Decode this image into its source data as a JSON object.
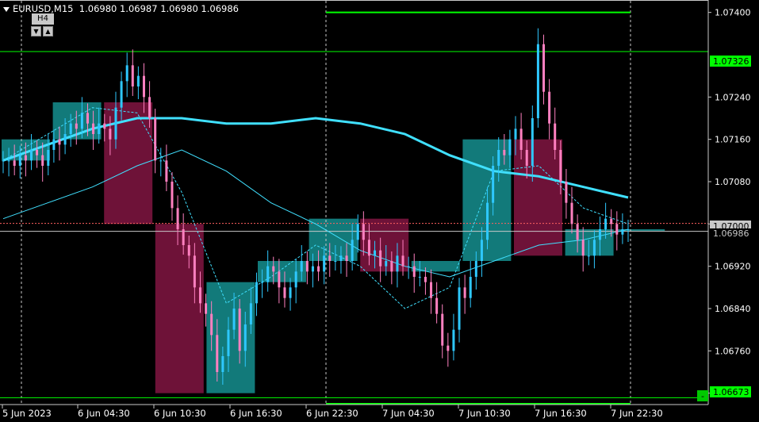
{
  "header": {
    "symbol_label": "EURUSD,M15",
    "ohlc": "1.06980 1.06987 1.06980 1.06986",
    "timeframe_label": "H4",
    "down_button": "▼",
    "up_button": "▲"
  },
  "price_axis": {
    "ticks": [
      "1.07400",
      "1.07240",
      "1.07160",
      "1.07080",
      "1.07000",
      "1.06920",
      "1.06840",
      "1.06760",
      "1.06680"
    ],
    "tick_values": [
      1.074,
      1.0724,
      1.0716,
      1.0708,
      1.07,
      1.0692,
      1.0684,
      1.0676,
      1.0668
    ],
    "ymin": 1.06663,
    "ymax": 1.07422
  },
  "time_axis": {
    "labels": [
      "5 Jun 2023",
      "6 Jun 04:30",
      "6 Jun 10:30",
      "6 Jun 16:30",
      "6 Jun 22:30",
      "7 Jun 04:30",
      "7 Jun 10:30",
      "7 Jun 16:30",
      "7 Jun 22:30"
    ]
  },
  "horizontal_lines": {
    "upper_level": {
      "value": 1.07326,
      "label": "1.07326",
      "color": "#00ff00"
    },
    "lower_level": {
      "value": 1.06673,
      "label": "1.06673",
      "color": "#00ff00"
    },
    "bid_line": {
      "value": 1.06986,
      "label": "1.06986",
      "color": "#c8c8c8"
    },
    "ask_line": {
      "value": 1.07001,
      "color": "#ff6060"
    },
    "range_top": {
      "value": 1.074,
      "color": "#00ff00"
    },
    "range_bottom": {
      "value": 1.0666,
      "color": "#00ff00"
    }
  },
  "price_tags": {
    "ask_tag": "1.07000",
    "bid_tag": "1.06986",
    "upper_tag": "1.07326",
    "lower_tag": "1.06673",
    "marker": "-"
  },
  "colors": {
    "bull_candle": "#2ec8ff",
    "bear_candle": "#ff80c0",
    "bull_h4_box": "#127a7a",
    "bear_h4_box": "#6e1238",
    "ma_slow": "#40e0ff",
    "ma_mid": "#40e0ff",
    "ma_fast_dashed": "#40e0ff",
    "grid_vertical": "#c8c8c8",
    "axis": "#c8c8c8"
  },
  "chart_data": {
    "type": "candlestick",
    "symbol": "EURUSD",
    "timeframe": "M15",
    "h4_boxes": [
      {
        "open": 1.0712,
        "close": 1.0716
      },
      {
        "open": 1.0716,
        "close": 1.0723
      },
      {
        "open": 1.0723,
        "close": 1.07
      },
      {
        "open": 1.07,
        "close": 1.0668
      },
      {
        "open": 1.0668,
        "close": 1.0689
      },
      {
        "open": 1.0689,
        "close": 1.0693
      },
      {
        "open": 1.0693,
        "close": 1.0701
      },
      {
        "open": 1.0701,
        "close": 1.0691
      },
      {
        "open": 1.0691,
        "close": 1.0693
      },
      {
        "open": 1.0693,
        "close": 1.0716
      },
      {
        "open": 1.0716,
        "close": 1.0694
      },
      {
        "open": 1.0694,
        "close": 1.0699
      },
      {
        "open": 1.0699,
        "close": 1.0699
      }
    ],
    "price_path": [
      1.0712,
      1.0712,
      1.0711,
      1.0713,
      1.0712,
      1.0714,
      1.0713,
      1.0711,
      1.0714,
      1.0716,
      1.0715,
      1.0717,
      1.0719,
      1.0718,
      1.0721,
      1.0719,
      1.0717,
      1.0719,
      1.0718,
      1.0716,
      1.0722,
      1.0727,
      1.073,
      1.0726,
      1.0728,
      1.0724,
      1.072,
      1.0712,
      1.0712,
      1.0708,
      1.0703,
      1.0699,
      1.0696,
      1.0694,
      1.0688,
      1.0685,
      1.0683,
      1.0679,
      1.0672,
      1.0675,
      1.068,
      1.0684,
      1.0676,
      1.0681,
      1.0685,
      1.0689,
      1.0689,
      1.0692,
      1.0691,
      1.0688,
      1.0686,
      1.0688,
      1.0691,
      1.0693,
      1.0691,
      1.0692,
      1.0691,
      1.0694,
      1.0693,
      1.0693,
      1.0694,
      1.0693,
      1.0697,
      1.07,
      1.0697,
      1.0694,
      1.0695,
      1.0692,
      1.0693,
      1.0691,
      1.0694,
      1.0692,
      1.0692,
      1.069,
      1.069,
      1.0689,
      1.0686,
      1.0683,
      1.0677,
      1.0676,
      1.068,
      1.0688,
      1.0686,
      1.069,
      1.0693,
      1.0697,
      1.0704,
      1.0711,
      1.0714,
      1.0713,
      1.0716,
      1.0718,
      1.0714,
      1.0711,
      1.072,
      1.0734,
      1.0725,
      1.0719,
      1.0714,
      1.0708,
      1.0704,
      1.07,
      1.0697,
      1.0694,
      1.0694,
      1.0697,
      1.0699,
      1.0701,
      1.07,
      1.0698,
      1.0699,
      1.0699
    ],
    "ma_slow": [
      1.0712,
      1.0715,
      1.0718,
      1.072,
      1.072,
      1.0719,
      1.0719,
      1.072,
      1.0719,
      1.0717,
      1.0713,
      1.071,
      1.0709,
      1.0707,
      1.0705
    ],
    "ma_mid": [
      1.0701,
      1.0704,
      1.0707,
      1.0711,
      1.0714,
      1.071,
      1.0704,
      1.07,
      1.0695,
      1.0692,
      1.069,
      1.0693,
      1.0696,
      1.0697,
      1.0699
    ],
    "ma_fast": [
      1.0712,
      1.0717,
      1.0722,
      1.0721,
      1.0706,
      1.0685,
      1.069,
      1.0696,
      1.0692,
      1.0684,
      1.0688,
      1.071,
      1.0711,
      1.0703,
      1.07
    ]
  }
}
